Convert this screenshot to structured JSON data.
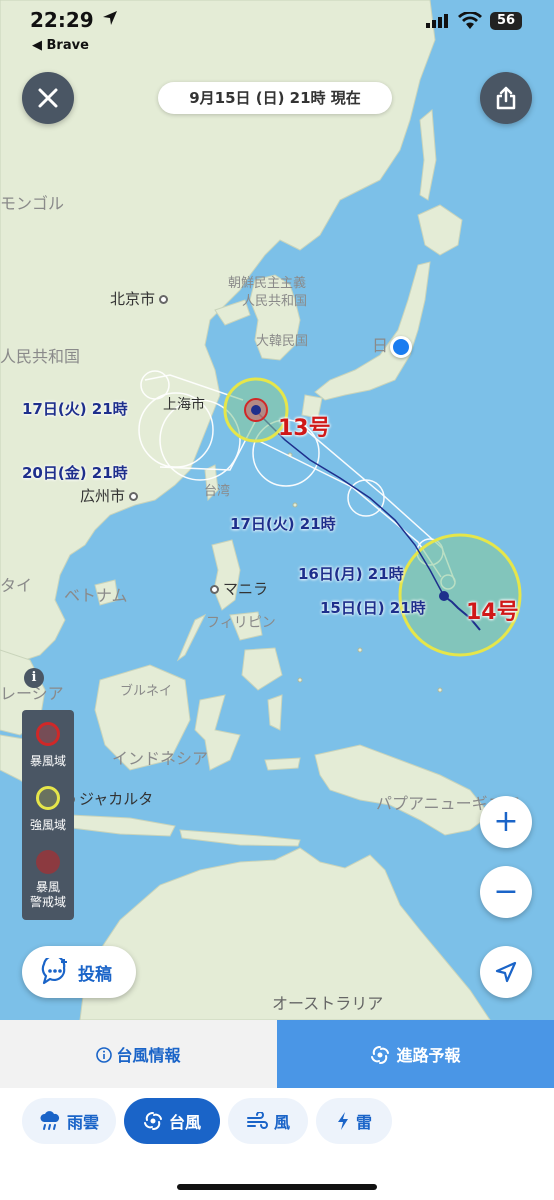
{
  "status_bar": {
    "time": "22:29",
    "back_app": "◀ Brave",
    "battery": "56"
  },
  "header": {
    "date_pill": "9月15日 (日) 21時 現在"
  },
  "map": {
    "countries": {
      "mongolia": "モンゴル",
      "china": "人民共和国",
      "north_korea": "朝鮮民主主義",
      "north_korea_2": "人民共和国",
      "south_korea": "大韓民国",
      "japan": "日",
      "taiwan": "台湾",
      "philippines": "フィリピン",
      "thailand": "タイ",
      "vietnam": "ベトナム",
      "malaysia": "レーシア",
      "brunei": "ブルネイ",
      "indonesia": "インドネシア",
      "papua": "パプアニューギニア",
      "australia": "オーストラリア"
    },
    "cities": {
      "beijing": "北京市",
      "shanghai": "上海市",
      "guangzhou": "広州市",
      "manila": "マニラ",
      "jakarta": "ジャカルタ"
    },
    "typhoon_13": {
      "number": "13号",
      "forecast_labels": [
        "17日(火) 21時",
        "20日(金) 21時"
      ]
    },
    "typhoon_14": {
      "number": "14号",
      "forecast_labels": [
        "17日(火) 21時",
        "16日(月) 21時",
        "15日(日) 21時"
      ]
    }
  },
  "legend": {
    "info": "i",
    "items": [
      {
        "label": "暴風域",
        "color": "#d02828"
      },
      {
        "label": "強風域",
        "color": "#e8e040"
      },
      {
        "label": "暴風\n警戒域",
        "color": "#b03030"
      }
    ]
  },
  "buttons": {
    "post": "投稿",
    "zoom_in": "+",
    "zoom_out": "−"
  },
  "tabs": {
    "info": "台風情報",
    "track": "進路予報"
  },
  "chips": [
    {
      "label": "雨雲",
      "icon": "rain-cloud-icon"
    },
    {
      "label": "台風",
      "icon": "typhoon-icon"
    },
    {
      "label": "風",
      "icon": "wind-icon"
    },
    {
      "label": "雷",
      "icon": "lightning-icon"
    }
  ],
  "colors": {
    "sea": "#7cc0e8",
    "land": "#e4ecd6",
    "accent": "#1a64c8",
    "tab_active": "#4a96e6",
    "typhoon_red": "#d01818",
    "storm_zone": "#e6e64a",
    "forecast_track": "#1e2f8c"
  }
}
